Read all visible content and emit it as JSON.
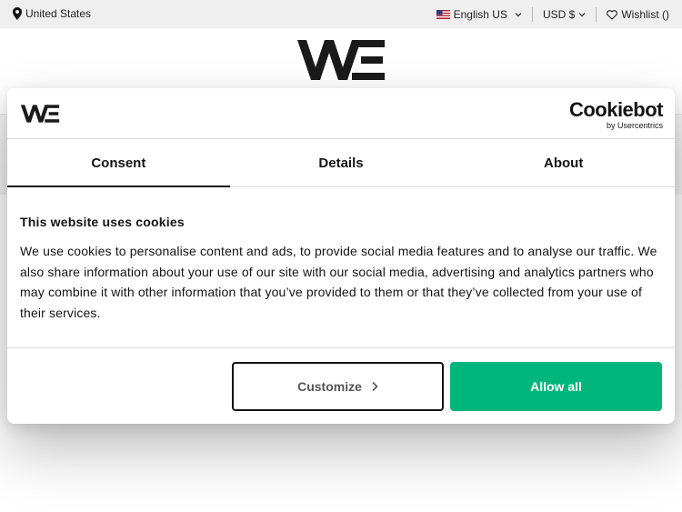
{
  "topbar": {
    "location": "United States",
    "language": "English US",
    "currency": "USD $",
    "wishlist": "Wishlist ()"
  },
  "brand": {
    "logo_text": "WE"
  },
  "dialog": {
    "provider_name": "Cookiebot",
    "provider_sub": "by Usercentrics",
    "tabs": [
      {
        "label": "Consent",
        "active": true
      },
      {
        "label": "Details",
        "active": false
      },
      {
        "label": "About",
        "active": false
      }
    ],
    "heading": "This website uses cookies",
    "text": "We use cookies to personalise content and ads, to provide social media features and to analyse our traffic. We also share information about your use of our site with our social media, advertising and analytics partners who may combine it with other information that you’ve provided to them or that they’ve collected from your use of their services.",
    "customize_label": "Customize",
    "allow_label": "Allow all"
  },
  "colors": {
    "accent": "#00b67a",
    "topbar_bg": "#efefef"
  }
}
